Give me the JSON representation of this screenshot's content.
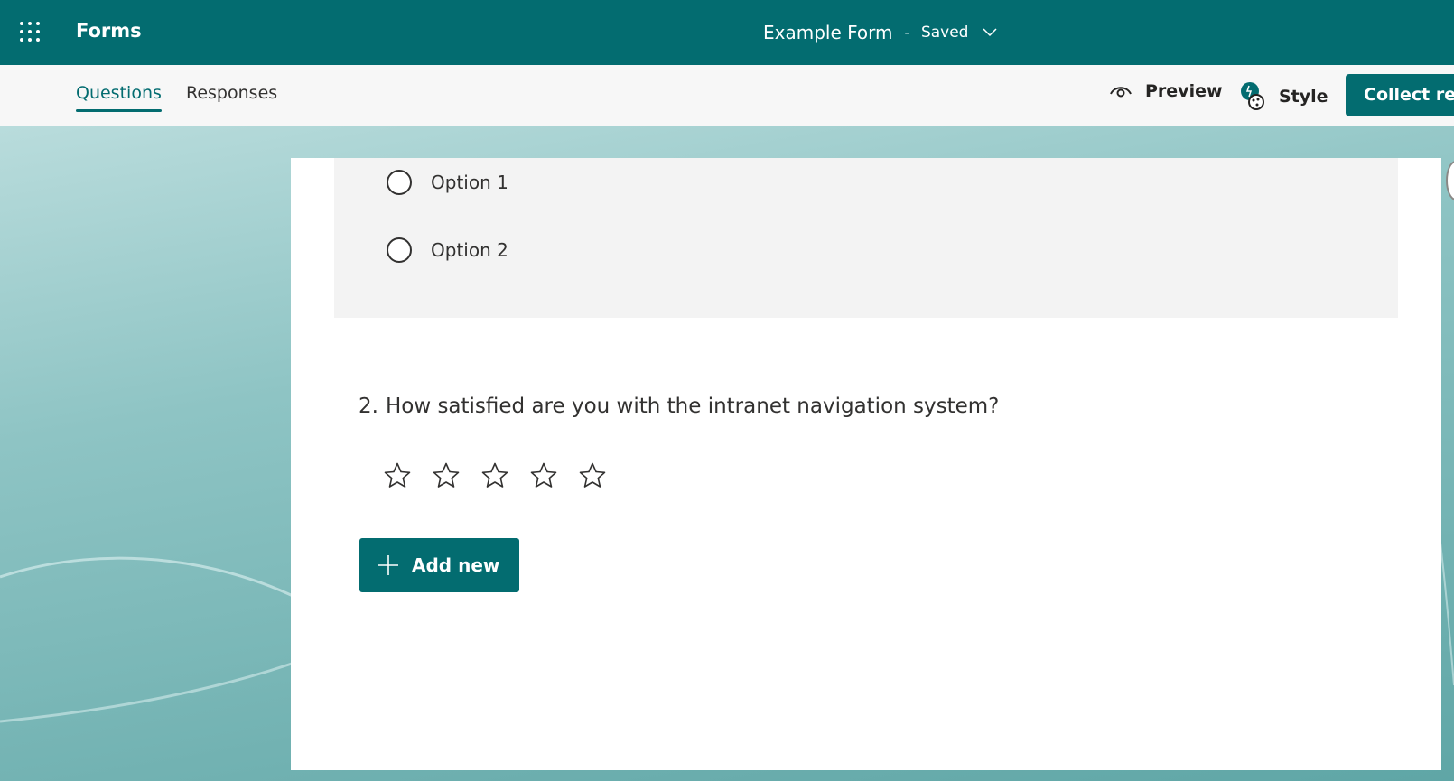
{
  "header": {
    "app_name": "Forms",
    "form_title": "Example Form",
    "separator": "-",
    "save_status": "Saved",
    "brand_color": "#036c70"
  },
  "tabs": [
    {
      "label": "Questions",
      "active": true
    },
    {
      "label": "Responses",
      "active": false
    }
  ],
  "commands": {
    "preview_label": "Preview",
    "style_label": "Style",
    "collect_label": "Collect responses"
  },
  "question1": {
    "options": [
      "Option 1",
      "Option 2"
    ]
  },
  "question2": {
    "number": "2.",
    "text": "How satisfied are you with the intranet navigation system?",
    "rating_max": 5,
    "rating_value": 0
  },
  "add_new_label": "Add new",
  "icons": {
    "app_launcher": "waffle-icon",
    "chevron": "chevron-down-icon",
    "preview": "eye-icon",
    "style": "palette-icon",
    "rating": "star-icon",
    "add": "plus-icon"
  }
}
